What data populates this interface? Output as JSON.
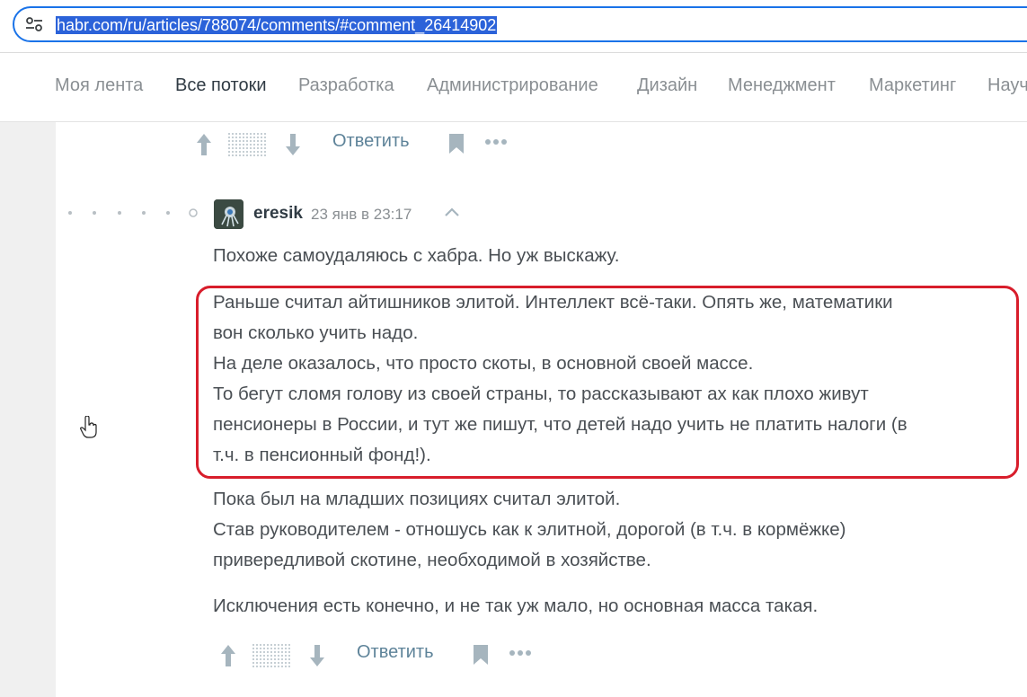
{
  "browser": {
    "url": "habr.com/ru/articles/788074/comments/#comment_26414902",
    "site_info_icon": "tune-icon"
  },
  "nav": {
    "items": [
      {
        "label": "Моя лента"
      },
      {
        "label": "Все потоки",
        "active": true
      },
      {
        "label": "Разработка"
      },
      {
        "label": "Администрирование"
      },
      {
        "label": "Дизайн"
      },
      {
        "label": "Менеджмент"
      },
      {
        "label": "Маркетинг"
      },
      {
        "label": "Научпоп"
      }
    ]
  },
  "prev_comment_actions": {
    "reply_label": "Ответить"
  },
  "comment": {
    "author": "eresik",
    "time": "23 янв в 23:17",
    "lines_intro": [
      "Похоже самоудаляюсь с хабра. Но уж выскажу."
    ],
    "lines_highlighted": [
      "Раньше считал айтишников элитой. Интеллект всё-таки. Опять же, математики",
      "вон сколько учить надо.",
      "На деле оказалось, что просто скоты, в основной своей массе.",
      "То бегут сломя голову из своей страны, то рассказывают ах как плохо живут",
      "пенсионеры в России, и тут же пишут, что детей надо учить не платить налоги (в",
      "т.ч. в пенсионный фонд!)."
    ],
    "lines_after": [
      "Пока был на младших позициях считал элитой.",
      "Став руководителем - отношусь как к элитной, дорогой (в т.ч. в кормёжке)",
      "привередливой скотине, необходимой в хозяйстве."
    ],
    "lines_final": [
      "Исключения есть конечно, и не так уж мало, но основная масса такая."
    ],
    "reply_label": "Ответить"
  },
  "colors": {
    "accent_blue": "#1a73e8",
    "url_selection": "#2b62d9",
    "highlight_red": "#d81d2b",
    "action_gray": "#a6b5be",
    "reply_link": "#5e8399"
  }
}
